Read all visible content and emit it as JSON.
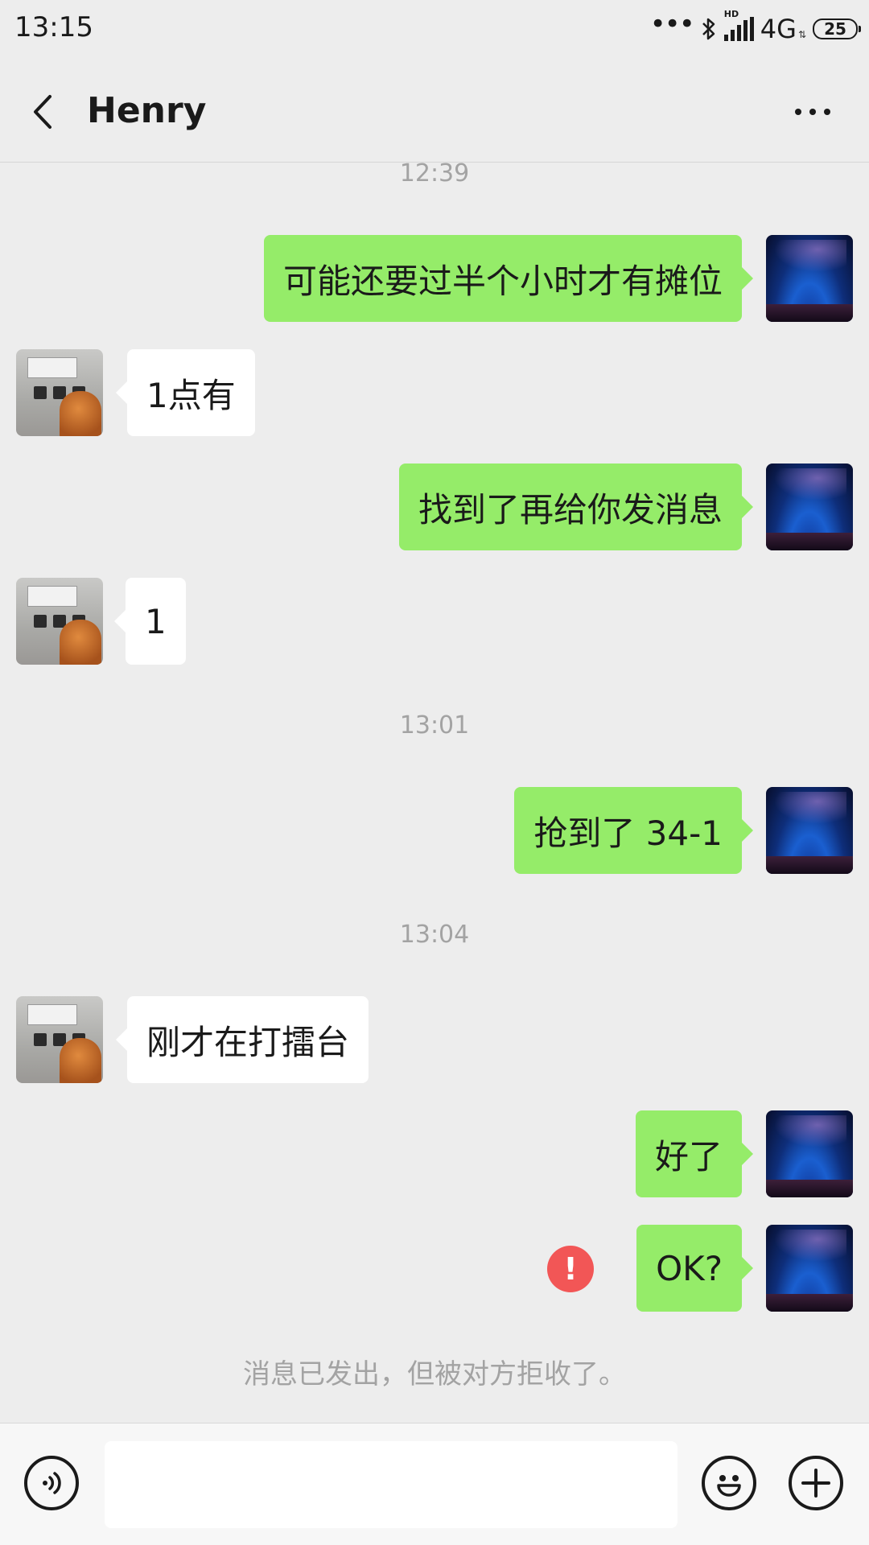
{
  "status_bar": {
    "time": "13:15",
    "dots": "•••",
    "hd_label": "HD",
    "network": "4G",
    "network_arrows": "⇅",
    "battery": "25"
  },
  "header": {
    "title": "Henry"
  },
  "timestamps": [
    "12:39",
    "13:01",
    "13:04"
  ],
  "messages": [
    {
      "sender": "self",
      "text": "可能还要过半个小时才有摊位"
    },
    {
      "sender": "other",
      "text": "1点有"
    },
    {
      "sender": "self",
      "text": "找到了再给你发消息"
    },
    {
      "sender": "other",
      "text": "1"
    },
    {
      "sender": "self",
      "text": "抢到了 34-1"
    },
    {
      "sender": "other",
      "text": "刚才在打擂台"
    },
    {
      "sender": "self",
      "text": "好了"
    },
    {
      "sender": "self",
      "text": "OK?",
      "status": "failed"
    }
  ],
  "error_mark": "!",
  "system_note": "消息已发出，但被对方拒收了。",
  "input_bar": {
    "placeholder": "",
    "value": ""
  },
  "icons": {
    "back": "chevron-left-icon",
    "more": "ellipsis-icon",
    "voice": "voice-icon",
    "emoji": "smiley-icon",
    "add": "plus-icon",
    "error": "exclamation-icon"
  },
  "colors": {
    "background": "#ededed",
    "self_bubble": "#95ec69",
    "other_bubble": "#ffffff",
    "error": "#f25656",
    "muted_text": "#a3a3a3"
  }
}
